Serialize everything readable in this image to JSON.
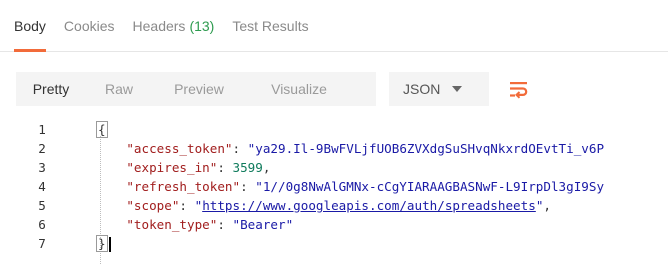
{
  "tabs": [
    {
      "label": "Body",
      "active": true
    },
    {
      "label": "Cookies",
      "active": false
    },
    {
      "label": "Headers",
      "count": "(13)",
      "active": false
    },
    {
      "label": "Test Results",
      "active": false
    }
  ],
  "toolbar": {
    "view_modes": [
      "Pretty",
      "Raw",
      "Preview",
      "Visualize"
    ],
    "active_view": "Pretty",
    "format_select": "JSON",
    "wrap_icon": "wrap-lines-icon"
  },
  "colors": {
    "accent": "#f26b3a",
    "count_green": "#2e9b4f",
    "json_key": "#a11d1d",
    "json_string": "#1a1aa6",
    "json_number": "#0f7b5c"
  },
  "response": {
    "line_numbers": [
      "1",
      "2",
      "3",
      "4",
      "5",
      "6",
      "7"
    ],
    "open_brace": "{",
    "close_brace": "}",
    "entries": [
      {
        "key": "\"access_token\"",
        "value": "\"ya29.Il-9BwFVLjfUOB6ZVXdgSuSHvqNkxrdOEvtTi_v6P",
        "type": "string"
      },
      {
        "key": "\"expires_in\"",
        "value": "3599",
        "type": "number"
      },
      {
        "key": "\"refresh_token\"",
        "value": "\"1//0g8NwAlGMNx-cCgYIARAAGBASNwF-L9IrpDl3gI9Sy",
        "type": "string"
      },
      {
        "key": "\"scope\"",
        "value_prefix": "\"",
        "value_link": "https://www.googleapis.com/auth/spreadsheets",
        "value_suffix": "\"",
        "type": "link"
      },
      {
        "key": "\"token_type\"",
        "value": "\"Bearer\"",
        "type": "string"
      }
    ]
  }
}
